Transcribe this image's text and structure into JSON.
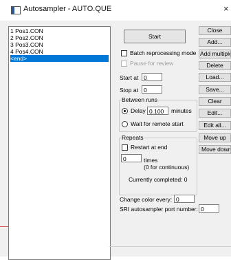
{
  "window": {
    "title": "Autosampler - AUTO.QUE",
    "close_glyph": "×"
  },
  "queue": {
    "items": [
      "1  Pos1.CON",
      "2  Pos2.CON",
      "3  Pos3.CON",
      "4  Pos4.CON",
      "<end>"
    ],
    "selected_index": 4
  },
  "controls": {
    "start_label": "Start",
    "batch_label": "Batch reprocessing mode",
    "pause_label": "Pause for review",
    "start_at_label": "Start at",
    "start_at_value": "0",
    "stop_at_label": "Stop at",
    "stop_at_value": "0",
    "between_runs_title": "Between runs",
    "delay_label": "Delay",
    "delay_value": "0.100",
    "minutes_label": "minutes",
    "wait_label": "Wait for remote start",
    "repeats_title": "Repeats",
    "restart_label": "Restart at end",
    "times_value": "0",
    "times_label": "times",
    "for_continuous_label": "(0 for continuous)",
    "completed_label": "Currently completed: 0",
    "change_color_label": "Change color every:",
    "change_color_value": "0",
    "sri_port_label": "SRI autosampler port number:",
    "sri_port_value": "0"
  },
  "side_buttons": {
    "close": "Close",
    "add": "Add...",
    "add_multiple": "Add multiple",
    "delete": "Delete",
    "load": "Load...",
    "save": "Save...",
    "clear": "Clear",
    "edit": "Edit...",
    "edit_all": "Edit all...",
    "move_up": "Move up",
    "move_down": "Move down"
  },
  "state": {
    "batch_checked": false,
    "pause_checked": false,
    "pause_enabled": false,
    "delay_selected": true,
    "restart_checked": false
  },
  "colors": {
    "selection": "#0078d7",
    "window_bg": "#f0f0f0"
  }
}
